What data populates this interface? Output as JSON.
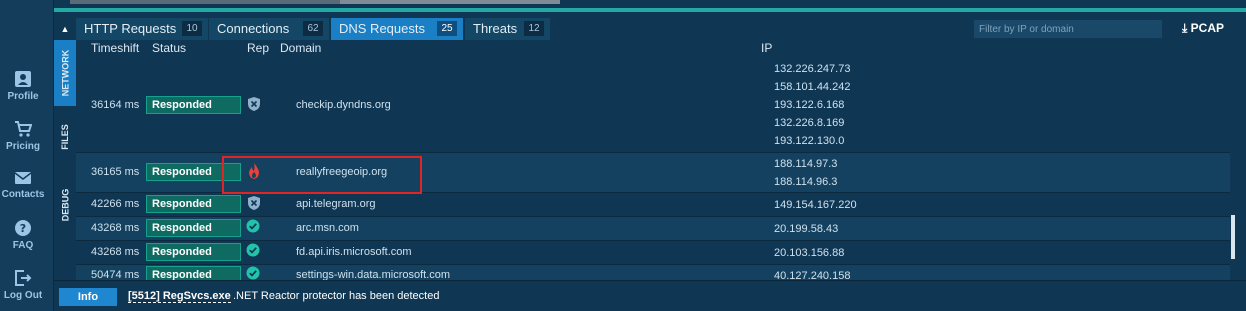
{
  "nav": [
    {
      "icon": "profile-icon",
      "label": "Profile"
    },
    {
      "icon": "cart-icon",
      "label": "Pricing"
    },
    {
      "icon": "mail-icon",
      "label": "Contacts"
    },
    {
      "icon": "help-icon",
      "label": "FAQ"
    },
    {
      "icon": "logout-icon",
      "label": "Log Out"
    }
  ],
  "tabs": [
    {
      "label": "HTTP Requests",
      "count": "10"
    },
    {
      "label": "Connections",
      "count": "62"
    },
    {
      "label": "DNS Requests",
      "count": "25"
    },
    {
      "label": "Threats",
      "count": "12"
    }
  ],
  "filter_placeholder": "Filter by IP or domain",
  "pcap_label": "PCAP",
  "side_tabs": [
    "NETWORK",
    "FILES",
    "DEBUG"
  ],
  "columns": {
    "timeshift": "Timeshift",
    "status": "Status",
    "rep": "Rep",
    "domain": "Domain",
    "ip": "IP"
  },
  "rows": [
    {
      "timeshift": "36164 ms",
      "status": "Responded",
      "rep": "unknown",
      "domain": "checkip.dyndns.org",
      "ips": [
        "132.226.247.73",
        "158.101.44.242",
        "193.122.6.168",
        "132.226.8.169",
        "193.122.130.0"
      ]
    },
    {
      "timeshift": "36165 ms",
      "status": "Responded",
      "rep": "malicious",
      "domain": "reallyfreegeoip.org",
      "ips": [
        "188.114.97.3",
        "188.114.96.3"
      ]
    },
    {
      "timeshift": "42266 ms",
      "status": "Responded",
      "rep": "unknown",
      "domain": "api.telegram.org",
      "ips": [
        "149.154.167.220"
      ]
    },
    {
      "timeshift": "43268 ms",
      "status": "Responded",
      "rep": "safe",
      "domain": "arc.msn.com",
      "ips": [
        "20.199.58.43"
      ]
    },
    {
      "timeshift": "43268 ms",
      "status": "Responded",
      "rep": "safe",
      "domain": "fd.api.iris.microsoft.com",
      "ips": [
        "20.103.156.88"
      ]
    },
    {
      "timeshift": "50474 ms",
      "status": "Responded",
      "rep": "safe",
      "domain": "settings-win.data.microsoft.com",
      "ips": [
        "40.127.240.158"
      ]
    }
  ],
  "statusbar": {
    "button": "Info",
    "process": "[5512] RegSvcs.exe",
    "message": ".NET Reactor protector has been detected"
  },
  "colors": {
    "accent": "#1a7fc4",
    "status": "#0f6b61",
    "malicious": "#e8423a",
    "safe": "#22c3a8",
    "unknown": "#8fb1cb",
    "highlight": "#e02525"
  }
}
